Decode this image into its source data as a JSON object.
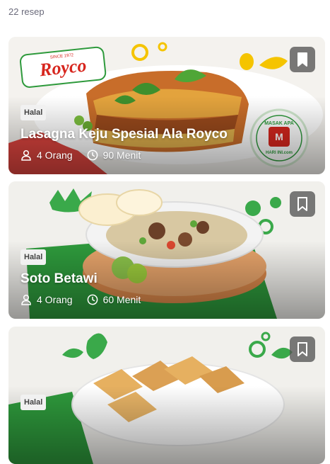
{
  "recipe_count": "22 resep",
  "colors": {
    "brand_green": "#2e9a3c",
    "brand_red": "#d7261e",
    "yellow": "#f5c400"
  },
  "recipes": [
    {
      "title": "Lasagna Keju Spesial Ala Royco",
      "badge": "Halal",
      "servings": "4 Orang",
      "duration": "90 Menit",
      "brand_logo": "Royco",
      "brand_tagline": "SINCE 1972",
      "stamp_top": "MASAK APA",
      "stamp_bottom": "HARI INI.com"
    },
    {
      "title": "Soto Betawi",
      "badge": "Halal",
      "servings": "4 Orang",
      "duration": "60 Menit"
    },
    {
      "title": "",
      "badge": "Halal"
    }
  ]
}
